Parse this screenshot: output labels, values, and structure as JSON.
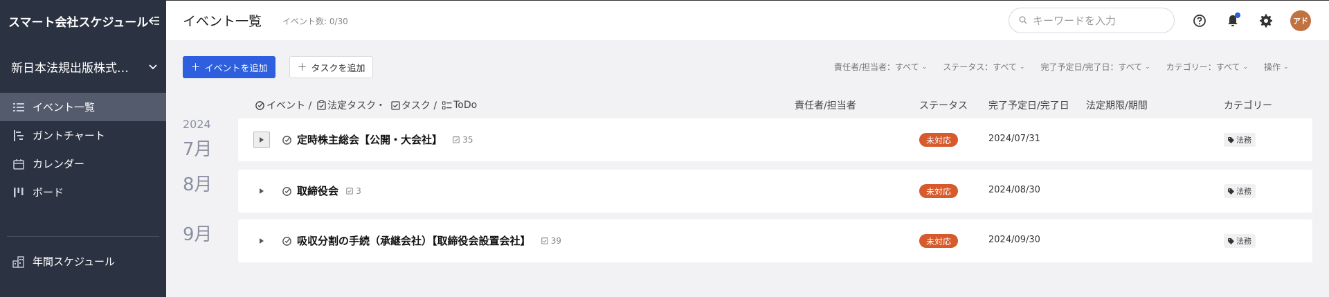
{
  "sidebar": {
    "app_title": "スマート会社スケジュール",
    "company": "新日本法規出版株式会…",
    "nav": [
      {
        "label": "イベント一覧",
        "icon": "list-icon",
        "active": true
      },
      {
        "label": "ガントチャート",
        "icon": "gantt-icon",
        "active": false
      },
      {
        "label": "カレンダー",
        "icon": "calendar-icon",
        "active": false
      },
      {
        "label": "ボード",
        "icon": "board-icon",
        "active": false
      }
    ],
    "annual": {
      "label": "年間スケジュール",
      "icon": "annual-schedule-icon"
    }
  },
  "header": {
    "title": "イベント一覧",
    "event_count": "イベント数: 0/30",
    "search_placeholder": "キーワードを入力",
    "avatar_initials": "アド"
  },
  "toolbar": {
    "add_event": "イベントを追加",
    "add_task": "タスクを追加",
    "filters": [
      "責任者/担当者：すべて",
      "ステータス：すべて",
      "完了予定日/完了日：すべて",
      "カテゴリー：すべて",
      "操作"
    ]
  },
  "table": {
    "columns": {
      "event": "イベント /",
      "legal_task": "法定タスク・",
      "task": "タスク /",
      "todo": "ToDo",
      "assignee": "責任者/担当者",
      "status": "ステータス",
      "due": "完了予定日/完了日",
      "legal_period": "法定期限/期間",
      "category": "カテゴリー"
    },
    "year": "2024",
    "months": [
      "7月",
      "8月",
      "9月"
    ],
    "rows": [
      {
        "title": "定時株主総会【公開・大会社】",
        "task_count": "35",
        "status": "未対応",
        "due": "2024/07/31",
        "category": "法務"
      },
      {
        "title": "取締役会",
        "task_count": "3",
        "status": "未対応",
        "due": "2024/08/30",
        "category": "法務"
      },
      {
        "title": "吸収分割の手続（承継会社）【取締役会設置会社】",
        "task_count": "39",
        "status": "未対応",
        "due": "2024/09/30",
        "category": "法務"
      }
    ]
  },
  "colors": {
    "sidebar_bg": "#2b3241",
    "primary": "#2d5fde",
    "status_badge": "#d65a2c",
    "avatar": "#c17241"
  }
}
